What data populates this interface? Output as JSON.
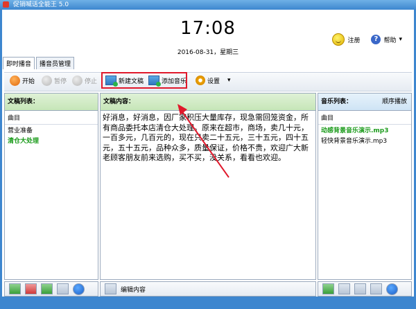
{
  "window": {
    "title": "促销喊话全能王 5.0"
  },
  "header": {
    "time": "17:08",
    "date": "2016-08-31，星期三",
    "register_label": "注册",
    "help_label": "帮助"
  },
  "tabs": [
    {
      "label": "即时播音"
    },
    {
      "label": "播音员管理"
    }
  ],
  "toolbar": {
    "start_label": "开始",
    "pause_label": "暂停",
    "stop_label": "停止",
    "new_doc_label": "新建文稿",
    "add_music_label": "添加音乐",
    "settings_label": "设置"
  },
  "doc_list": {
    "title": "文稿列表：",
    "column": "曲目",
    "items": [
      "营业准备",
      "清仓大处理"
    ]
  },
  "doc_content": {
    "title": "文稿内容：",
    "text": "好消息，好消息，因厂家积压大量库存，现急需回笼资金，所有商品委托本店清仓大处理。原来在超市，商场，卖几十元，一百多元，几百元的，现在只卖二十五元，三十五元，四十五元，五十五元，品种众多，质量保证，价格不贵，欢迎广大新老顾客朋友前来选购，买不买，没关系，看看也欢迎。",
    "edit_label": "编辑内容"
  },
  "music_list": {
    "title": "音乐列表：",
    "mode": "顺序播放",
    "column": "曲目",
    "items": [
      "动感背景音乐演示.mp3",
      "轻快背景音乐演示.mp3"
    ]
  },
  "colors": {
    "accent": "#3d86cf",
    "highlight": "#e0182b"
  }
}
